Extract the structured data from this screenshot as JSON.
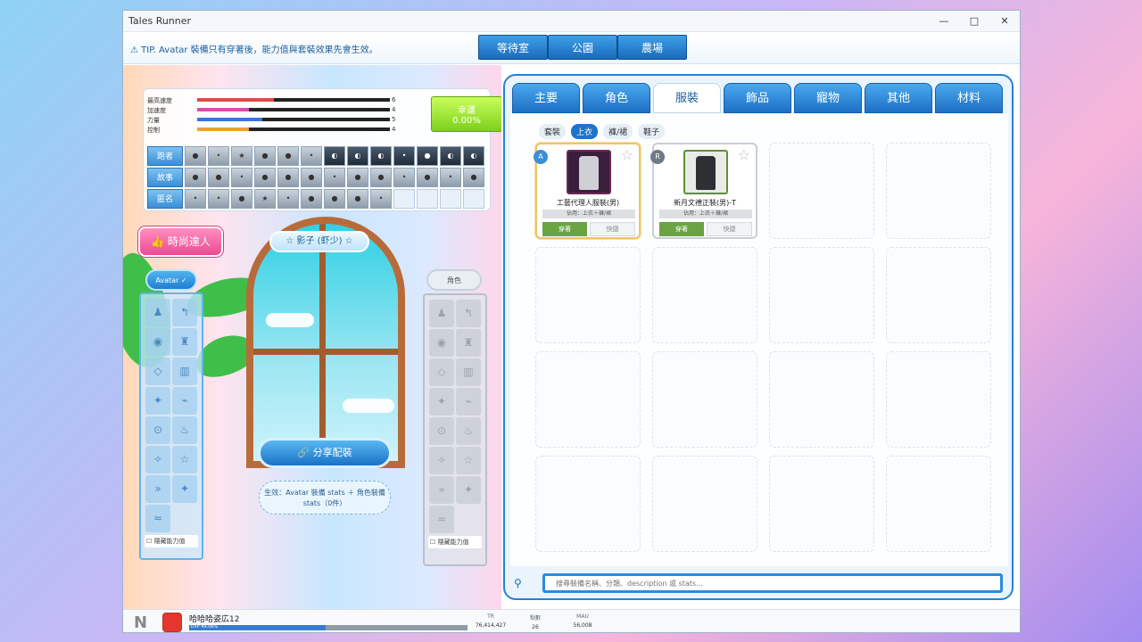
{
  "window": {
    "title": "Tales Runner",
    "controls": [
      "—",
      "□",
      "✕"
    ]
  },
  "tip": "⚠ TIP. Avatar 裝備只有穿著後，能力值與套裝效果先會生效。",
  "top_nav": [
    "等待室",
    "公園",
    "農場"
  ],
  "stats": {
    "rows": [
      {
        "label": "最高速度",
        "value": "6",
        "color": "#e04848",
        "level": 0.4
      },
      {
        "label": "加速度",
        "value": "4",
        "color": "#e04aa8",
        "level": 0.27
      },
      {
        "label": "力量",
        "value": "5",
        "color": "#3a74e0",
        "level": 0.34
      },
      {
        "label": "控制",
        "value": "4",
        "color": "#f0a030",
        "level": 0.27
      }
    ],
    "luck_label": "幸運",
    "luck_value": "0.00%",
    "grid_rows": [
      {
        "label": "跑者",
        "cells": [
          "●",
          "•",
          "★",
          "●",
          "●",
          "•",
          "◐",
          "◐",
          "◐",
          "•",
          "●",
          "◐",
          "◐"
        ],
        "dark_from": 6
      },
      {
        "label": "故事",
        "cells": [
          "●",
          "●",
          "•",
          "●",
          "●",
          "●",
          "•",
          "●",
          "●",
          "•",
          "●",
          "•",
          "●"
        ],
        "dark_from": 99
      },
      {
        "label": "匿名",
        "cells": [
          "•",
          "•",
          "●",
          "★",
          "•",
          "●",
          "●",
          "●",
          "•",
          "",
          "",
          "",
          ""
        ],
        "dark_from": 99
      }
    ]
  },
  "fashion_badge": "👍 時尚達人",
  "avatar_pill": "Avatar ✓",
  "character_pill": "角色",
  "shadow_label": "☆ 影子 (虾少) ☆",
  "share_button": "🔗 分享配裝",
  "effect_text": "生效：Avatar 裝備 stats ＋ 角色裝備 stats（0件）",
  "hide_stats_label": "隱藏能力值",
  "left_icons": [
    "♟",
    "↰",
    "◉",
    "♜",
    "◇",
    "▥",
    "✦",
    "⌁",
    "⊙",
    "♨",
    "✧",
    "☆",
    "»",
    "✦",
    "≈"
  ],
  "right_icons": [
    "♟",
    "↰",
    "◉",
    "♜",
    "◇",
    "▥",
    "✦",
    "⌁",
    "⊙",
    "♨",
    "✧",
    "☆",
    "»",
    "✦",
    "≈"
  ],
  "tabs": [
    "主要",
    "角色",
    "服裝",
    "飾品",
    "寵物",
    "其他",
    "材料"
  ],
  "active_tab": "服裝",
  "subtabs": [
    "套裝",
    "上衣",
    "褲/裙",
    "鞋子"
  ],
  "active_subtab": "上衣",
  "items": [
    {
      "grade": "A",
      "grade_color": "#3a8fd6",
      "name": "工藝代理人服裝(男)",
      "use": "佔用：上衣＋褲/裙",
      "wear": "穿著",
      "quick": "快捷",
      "thumb": "#3a1f3c"
    },
    {
      "grade": "R",
      "grade_color": "#6f7a85",
      "name": "新月文禮正裝(男)-T",
      "use": "佔用：上衣＋褲/裙",
      "wear": "穿著",
      "quick": "快捷",
      "thumb": "#e8ebe6"
    }
  ],
  "search": {
    "placeholder": "搜尋裝備名稱、分類、description 或 stats..."
  },
  "status": {
    "name": "哈哈哈姿広12",
    "exp_text": "EXP 49.06%",
    "exp_level": 0.49,
    "tr_label": "TR",
    "tr_value": "76,414,427",
    "pt_label": "點數",
    "pt_value": "26",
    "mau_label": "MAU",
    "mau_value": "56,008"
  }
}
